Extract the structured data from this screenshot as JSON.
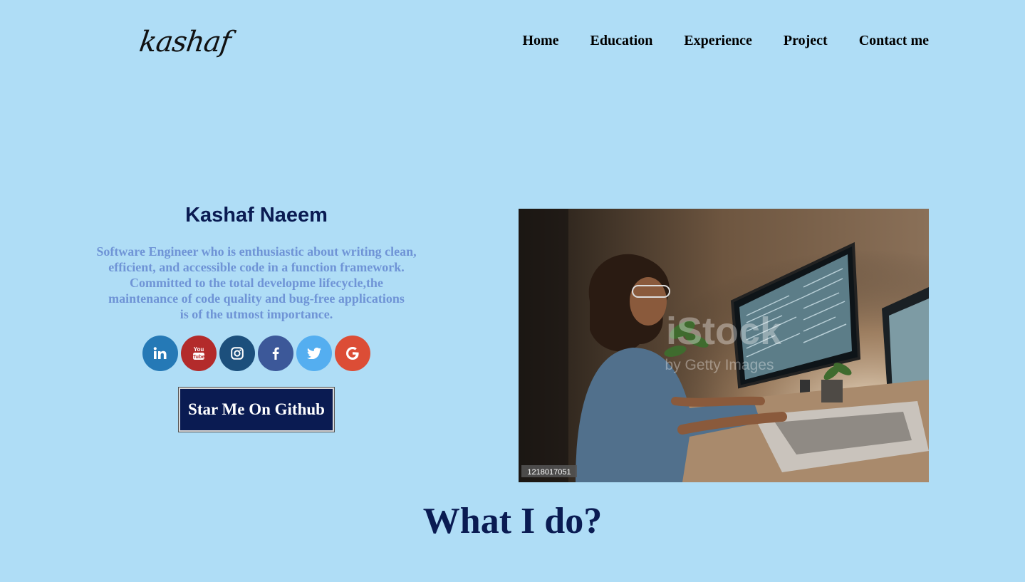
{
  "header": {
    "logo_text": "kashaf",
    "nav": [
      {
        "label": "Home"
      },
      {
        "label": "Education"
      },
      {
        "label": "Experience"
      },
      {
        "label": "Project"
      },
      {
        "label": "Contact me"
      }
    ]
  },
  "intro": {
    "name": "Kashaf Naeem",
    "bio_lines": [
      "Software Engineer who is enthusiastic about writing clean,",
      "efficient, and accessible code in a function framework.",
      "Committed to the total developme lifecycle,the",
      "maintenance of code quality and bug-free applications",
      "is of the utmost importance."
    ],
    "socials": [
      {
        "icon": "linkedin-icon",
        "glyph": "in",
        "color": "#2579b6"
      },
      {
        "icon": "youtube-icon",
        "glyph": "You",
        "color": "#b32b2b"
      },
      {
        "icon": "instagram-icon",
        "glyph": "",
        "color": "#1c4f7c"
      },
      {
        "icon": "facebook-icon",
        "glyph": "f",
        "color": "#3c5899"
      },
      {
        "icon": "twitter-icon",
        "glyph": "",
        "color": "#54aef0"
      },
      {
        "icon": "google-icon",
        "glyph": "G",
        "color": "#dc4d36"
      }
    ],
    "github_button": "Star Me On Github"
  },
  "hero_image": {
    "watermark": "iStock",
    "watermark_sub": "by Getty Images",
    "stock_id": "1218017051"
  },
  "section": {
    "title": "What I do?"
  }
}
